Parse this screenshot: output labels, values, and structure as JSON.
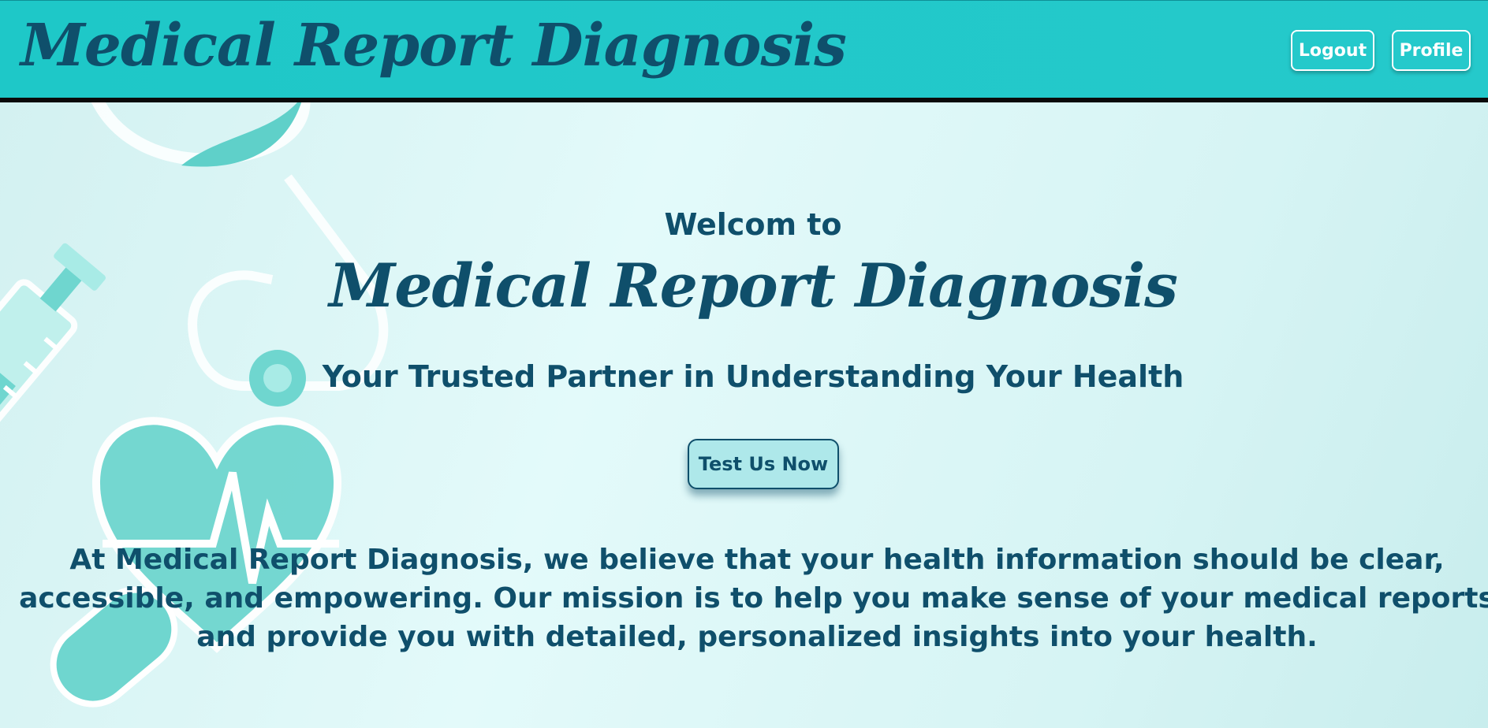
{
  "header": {
    "brand": "Medical Report Diagnosis",
    "logout_label": "Logout",
    "profile_label": "Profile"
  },
  "hero": {
    "welcome": "Welcom to",
    "title": "Medical Report Diagnosis",
    "tagline": "Your Trusted Partner in Understanding Your Health",
    "cta_label": "Test Us Now",
    "mission": "At Medical Report Diagnosis, we believe that your health information should be clear, accessible, and empowering. Our mission is to help you make sense of your medical reports and provide you with detailed, personalized insights into your health."
  },
  "decor": {
    "icons": [
      "stethoscope-icon",
      "syringe-icon",
      "heart-pulse-icon",
      "pill-icon"
    ]
  },
  "colors": {
    "navbar": "#1ec8c8",
    "brand_text": "#0f4f6b",
    "hero_background": "#d9f5f5",
    "cta_background": "#aee8ea",
    "decor_teal": "#6fd6cf"
  }
}
